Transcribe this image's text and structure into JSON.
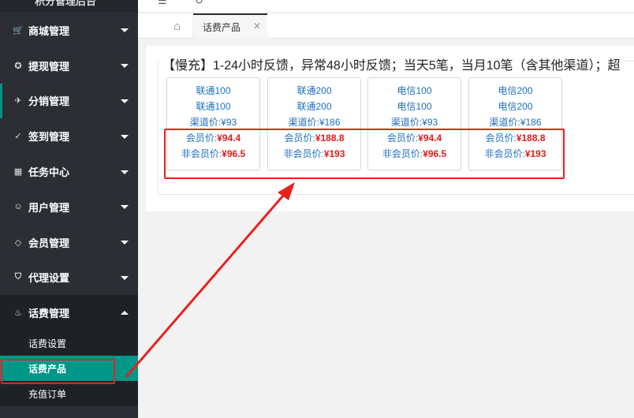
{
  "sidebar": {
    "brand": "积分管理后台",
    "menu": [
      {
        "label": "商城管理",
        "icon": "cart-icon",
        "glyph": "🛒"
      },
      {
        "label": "提现管理",
        "icon": "withdraw-icon",
        "glyph": "✪"
      },
      {
        "label": "分销管理",
        "icon": "paper-plane-icon",
        "glyph": "✈"
      },
      {
        "label": "签到管理",
        "icon": "check-icon",
        "glyph": "✓"
      },
      {
        "label": "任务中心",
        "icon": "grid-icon",
        "glyph": "▦"
      },
      {
        "label": "用户管理",
        "icon": "user-icon",
        "glyph": "☺"
      },
      {
        "label": "会员管理",
        "icon": "diamond-icon",
        "glyph": "◇"
      },
      {
        "label": "代理设置",
        "icon": "shield-icon",
        "glyph": "⛉"
      },
      {
        "label": "话费管理",
        "icon": "flame-icon",
        "glyph": "♨"
      }
    ],
    "submenu": [
      {
        "label": "话费设置"
      },
      {
        "label": "话费产品"
      },
      {
        "label": "充值订单"
      }
    ]
  },
  "tabs": {
    "current": "话费产品",
    "close": "✕",
    "home_glyph": "⌂"
  },
  "panel": {
    "legend": "【慢充】1-24小时反馈，异常48小时反馈；当天5笔，当月10笔（含其他渠道）；超",
    "cards": [
      {
        "name": "联通100",
        "subname": "联通100",
        "channel_label": "渠道价:¥93",
        "member_label": "会员价:",
        "member_price": "¥94.4",
        "nonmember_label": "非会员价:",
        "nonmember_price": "¥96.5"
      },
      {
        "name": "联通200",
        "subname": "联通200",
        "channel_label": "渠道价:¥186",
        "member_label": "会员价:",
        "member_price": "¥188.8",
        "nonmember_label": "非会员价:",
        "nonmember_price": "¥193"
      },
      {
        "name": "电信100",
        "subname": "电信100",
        "channel_label": "渠道价:¥93",
        "member_label": "会员价:",
        "member_price": "¥94.4",
        "nonmember_label": "非会员价:",
        "nonmember_price": "¥96.5"
      },
      {
        "name": "电信200",
        "subname": "电信200",
        "channel_label": "渠道价:¥186",
        "member_label": "会员价:",
        "member_price": "¥188.8",
        "nonmember_label": "非会员价:",
        "nonmember_price": "¥193"
      }
    ]
  },
  "colors": {
    "sidebar_bg": "#2b2f33",
    "accent": "#009688",
    "price_red": "#e51a1a",
    "link_blue": "#1e6fc0",
    "annotation_red": "#e8221d"
  }
}
